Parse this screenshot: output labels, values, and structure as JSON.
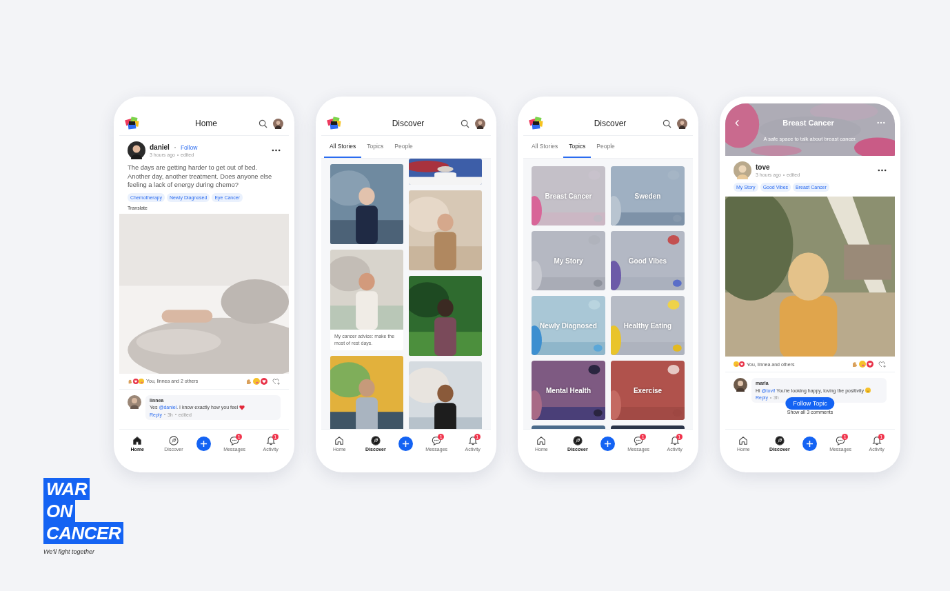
{
  "phones": [
    {
      "kind": "feed",
      "header": {
        "title": "Home"
      },
      "post": {
        "author": "daniel",
        "follow": "Follow",
        "time": "3 hours ago",
        "edited": "edited",
        "body": "The days are getting harder to get out of bed. Another day, another treatment. Does anyone else feeling a lack of energy during chemo?",
        "tags": [
          "Chemotherapy",
          "Newly Diagnosed",
          "Eye Cancer"
        ],
        "translate": "Translate",
        "reactions": "You, linnea and 2 others"
      },
      "comment": {
        "author": "linnea",
        "before": "Yes ",
        "mention": "@daniel",
        "after": ". I know exactly how you feel",
        "reply": "Reply",
        "time": "3h",
        "edited": "edited"
      },
      "nav": [
        {
          "kind": "home",
          "label": "Home",
          "selected": true
        },
        {
          "kind": "discover",
          "label": "Discover",
          "selected": false
        },
        {
          "kind": "add"
        },
        {
          "kind": "messages",
          "label": "Messages",
          "selected": false,
          "badge": "1"
        },
        {
          "kind": "activity",
          "label": "Activity",
          "selected": false,
          "badge": "1"
        }
      ]
    },
    {
      "kind": "stories",
      "header": {
        "title": "Discover"
      },
      "tabs": [
        {
          "label": "All Stories",
          "selected": true
        },
        {
          "label": "Topics",
          "selected": false
        },
        {
          "label": "People",
          "selected": false
        }
      ],
      "columns": [
        [
          {
            "kind": "picture"
          },
          {
            "kind": "captioned",
            "caption": "My cancer advice: make the most of rest days."
          },
          {
            "kind": "picture"
          }
        ],
        [
          {
            "kind": "picture"
          },
          {
            "kind": "picture"
          },
          {
            "kind": "picture"
          },
          {
            "kind": "picture"
          }
        ]
      ],
      "nav": [
        {
          "kind": "home",
          "label": "Home",
          "selected": false
        },
        {
          "kind": "discover",
          "label": "Discover",
          "selected": true
        },
        {
          "kind": "add"
        },
        {
          "kind": "messages",
          "label": "Messages",
          "selected": false,
          "badge": "1"
        },
        {
          "kind": "activity",
          "label": "Activity",
          "selected": false,
          "badge": "1"
        }
      ]
    },
    {
      "kind": "topics",
      "header": {
        "title": "Discover"
      },
      "tabs": [
        {
          "label": "All Stories",
          "selected": false
        },
        {
          "label": "Topics",
          "selected": true
        },
        {
          "label": "People",
          "selected": false
        }
      ],
      "topics": [
        {
          "title": "Breast Cancer"
        },
        {
          "title": "Sweden"
        },
        {
          "title": "My Story"
        },
        {
          "title": "Good Vibes"
        },
        {
          "title": "Newly Diagnosed"
        },
        {
          "title": "Healthy Eating"
        },
        {
          "title": "Mental Health"
        },
        {
          "title": "Exercise"
        }
      ],
      "nav": [
        {
          "kind": "home",
          "label": "Home",
          "selected": false
        },
        {
          "kind": "discover",
          "label": "Discover",
          "selected": true
        },
        {
          "kind": "add"
        },
        {
          "kind": "messages",
          "label": "Messages",
          "selected": false,
          "badge": "1"
        },
        {
          "kind": "activity",
          "label": "Activity",
          "selected": false,
          "badge": "1"
        }
      ]
    },
    {
      "kind": "topic_page",
      "topic": {
        "title": "Breast Cancer",
        "subtitle": "A safe space to talk about breast cancer."
      },
      "post": {
        "author": "tove",
        "time": "3 hours ago",
        "edited": "edited",
        "tags": [
          "My Story",
          "Good Vibes",
          "Breast Cancer"
        ],
        "reactions": "You, linnea and others"
      },
      "comment": {
        "author": "marla",
        "before": "Hi ",
        "mention": "@tovi!",
        "after": " You're looking happy, loving the positivity",
        "reply": "Reply",
        "time": "3h"
      },
      "follow_topic": "Follow Topic",
      "show_all": "Show all 3 comments",
      "nav": [
        {
          "kind": "home",
          "label": "Home",
          "selected": false
        },
        {
          "kind": "discover",
          "label": "Discover",
          "selected": true
        },
        {
          "kind": "add"
        },
        {
          "kind": "messages",
          "label": "Messages",
          "selected": false,
          "badge": "1"
        },
        {
          "kind": "activity",
          "label": "Activity",
          "selected": false,
          "badge": "1"
        }
      ]
    }
  ],
  "brand": {
    "words": [
      "WAR",
      "ON",
      "CANCER"
    ],
    "tagline": "We'll fight together"
  }
}
